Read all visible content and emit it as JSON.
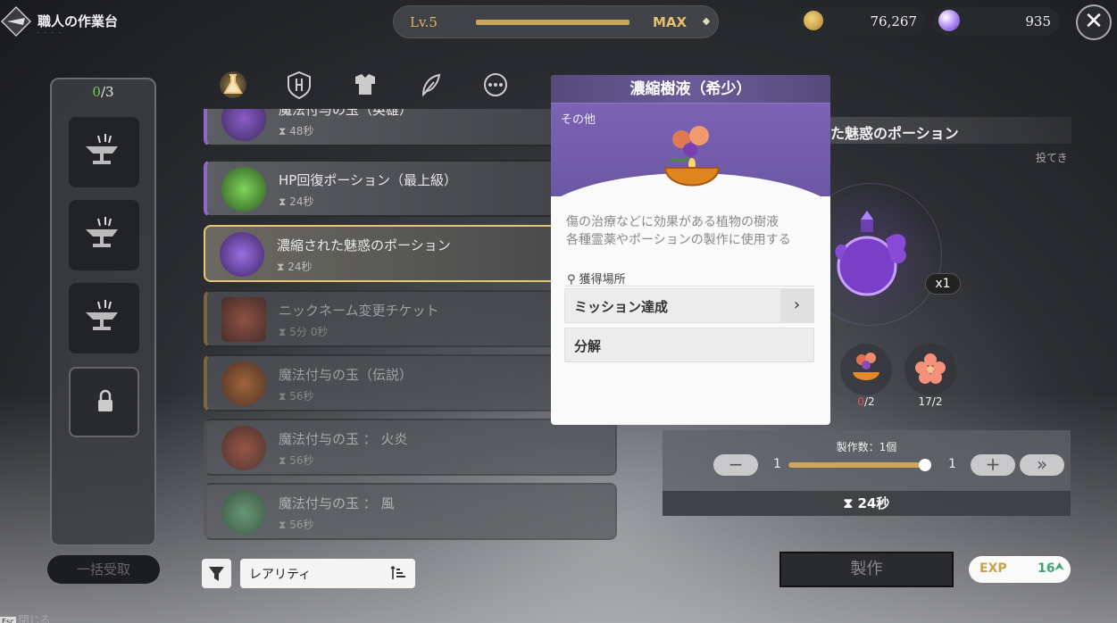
{
  "header": {
    "title": "職人の作業台",
    "subtitle": "- - - -",
    "level_label": "Lv.5",
    "level_max": "MAX",
    "gold": "76,267",
    "gems": "935"
  },
  "slots": {
    "filled": "0",
    "total": "/3",
    "collect_all": "一括受取"
  },
  "close_hint": {
    "key": "Esc",
    "label": "閉じる"
  },
  "tabs": [
    {
      "icon": "flask-icon",
      "active": true
    },
    {
      "icon": "shield-rune-icon"
    },
    {
      "icon": "armor-icon"
    },
    {
      "icon": "feather-icon"
    },
    {
      "icon": "more-icon"
    }
  ],
  "list": [
    {
      "name": "魔法付与の玉（英雄）",
      "time": "48秒",
      "rarity": "purple"
    },
    {
      "name": "HP回復ポーション（最上級）",
      "time": "24秒",
      "rarity": "purple"
    },
    {
      "name": "濃縮された魅惑のポーション",
      "time": "24秒",
      "rarity": "purple",
      "selected": true
    },
    {
      "name": "ニックネーム変更チケット",
      "time": "5分 0秒",
      "rarity": "gold"
    },
    {
      "name": "魔法付与の玉（伝説）",
      "time": "56秒",
      "rarity": "gold"
    },
    {
      "name": "魔法付与の玉 ： 火炎",
      "time": "56秒",
      "rarity": "grey"
    },
    {
      "name": "魔法付与の玉 ： 風",
      "time": "56秒",
      "rarity": "grey"
    }
  ],
  "filter": {
    "rarity_label": "レアリティ"
  },
  "detail": {
    "title": "た魅惑のポーション",
    "discard": "投てき",
    "quantity": "x1",
    "materials": [
      {
        "icon": "resin-bowl-icon",
        "have": "0",
        "need": "/2"
      },
      {
        "icon": "orange-flower-icon",
        "have": "17",
        "need": "/2"
      }
    ],
    "craft_count_label": "製作数：1個",
    "slider_min": "1",
    "slider_max": "1",
    "slider_value": 1,
    "minus": "−",
    "plus": "+",
    "max": "»",
    "craft_time": "24秒",
    "craft_button": "製作",
    "exp_label": "EXP",
    "exp_value": "16"
  },
  "popup": {
    "title": "濃縮樹液（希少）",
    "category": "その他",
    "description": "傷の治療などに効果がある植物の樹液\n各種霊薬やポーションの製作に使用する",
    "source_title": "獲得場所",
    "sources": [
      {
        "label": "ミッション達成",
        "has_arrow": true
      },
      {
        "label": "分解",
        "has_arrow": false
      }
    ]
  },
  "colors": {
    "accent_gold": "#e3c676",
    "popup_header": "#6a5b98",
    "rare_purple": "#8e69c9",
    "exp_green": "#3fa56c",
    "missing_red": "#e65050"
  }
}
